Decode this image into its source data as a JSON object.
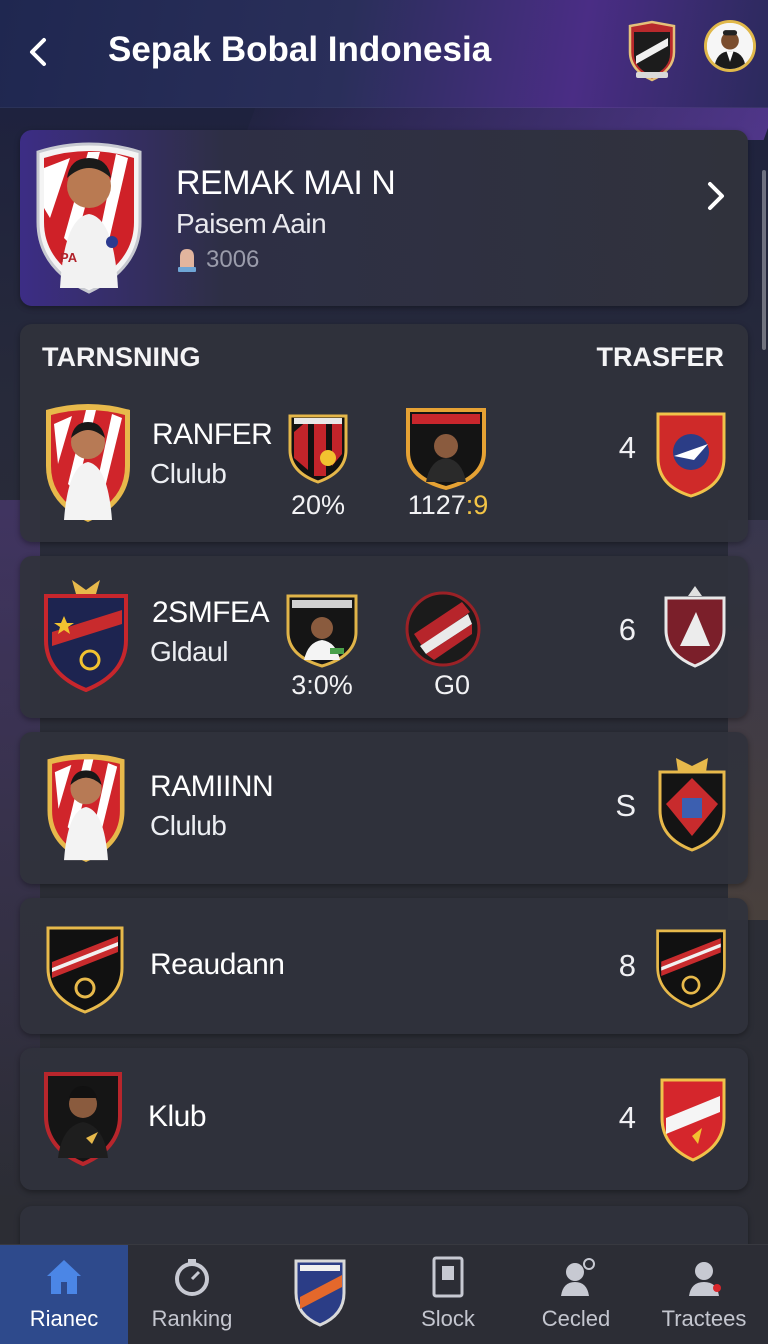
{
  "header": {
    "title": "Sepak Bobal Indonesia"
  },
  "featured": {
    "name": "REMAK MAI N",
    "subtitle": "Paisem Aain",
    "stat": "3006",
    "badge_text": "PA"
  },
  "section": {
    "left_heading": "TARNSNING",
    "right_heading": "TRASFER"
  },
  "rows": [
    {
      "name": "RANFER",
      "sub": "Clulub",
      "stat1": "20%",
      "stat2_main": "1127",
      "stat2_hl": ":9",
      "count": "4"
    },
    {
      "name": "2SMFEA",
      "sub": "Gldaul",
      "stat1": "3:0%",
      "stat2_main": "G0",
      "stat2_hl": "",
      "count": "6"
    },
    {
      "name": "RAMIINN",
      "sub": "Clulub",
      "count": "S"
    },
    {
      "name": "Reaudann",
      "count": "8"
    },
    {
      "name": "Klub",
      "count": "4"
    }
  ],
  "nav": [
    {
      "label": "Rianec",
      "icon": "home-icon",
      "active": true
    },
    {
      "label": "Ranking",
      "icon": "stopwatch-icon"
    },
    {
      "label": "",
      "icon": "club-crest-icon"
    },
    {
      "label": "Slock",
      "icon": "card-icon"
    },
    {
      "label": "Cecled",
      "icon": "person-chat-icon"
    },
    {
      "label": "Tractees",
      "icon": "person-icon"
    }
  ],
  "colors": {
    "accent_red": "#d8262c",
    "gold": "#f3c445",
    "nav_active": "#2e4a8c"
  }
}
